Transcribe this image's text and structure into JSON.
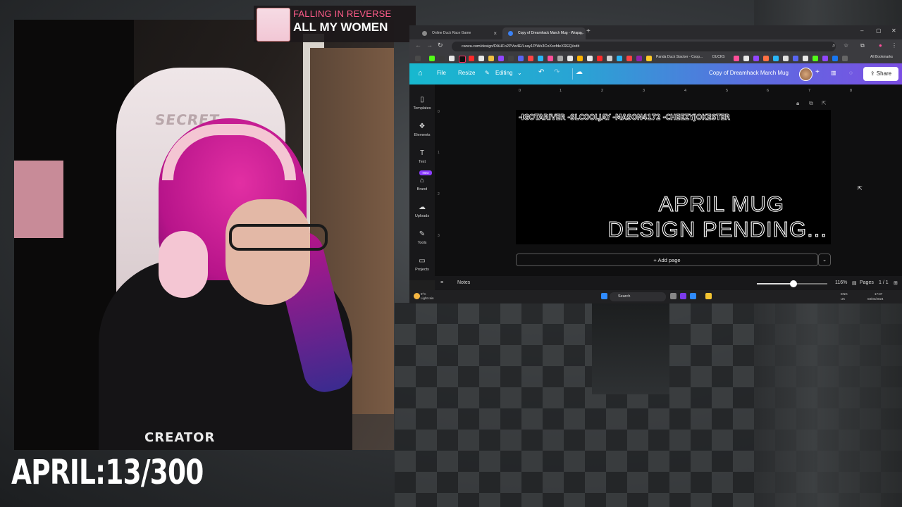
{
  "music": {
    "artist": "FALLING IN REVERSE",
    "song": "ALL MY WOMEN",
    "accent_color": "#ff5c8a"
  },
  "counter": {
    "text": "APRIL:13/300"
  },
  "webcam": {
    "chair_logo": "SECRET",
    "shirt_text": "CREATOR",
    "hair_color": "#d6209a"
  },
  "browser": {
    "tabs": [
      {
        "label": "Online Duck Race Game",
        "active": false,
        "icon": "duck-favicon-icon"
      },
      {
        "label": "Copy of Dreamhack March Mug - Wrapa...",
        "active": true,
        "icon": "canva-favicon-icon"
      }
    ],
    "url": "canva.com/design/DAHFo2PVw4E/Lsay1PIWs3CoXsxfdeXREQ/edit",
    "bookmark_items": [
      "Panda Duck Stacker - Coop...",
      "DUCKS",
      "All Bookmarks"
    ]
  },
  "canva": {
    "header": {
      "file": "File",
      "resize": "Resize",
      "editing": "Editing",
      "doc_title": "Copy of Dreamhack March Mug",
      "share": "Share",
      "accent_start": "#17b8cf",
      "accent_end": "#7b4ee3"
    },
    "sidebar": [
      {
        "label": "Templates",
        "icon": "templates-icon"
      },
      {
        "label": "Elements",
        "icon": "elements-icon"
      },
      {
        "label": "Text",
        "icon": "text-icon"
      },
      {
        "label": "Brand",
        "icon": "brand-icon"
      },
      {
        "label": "Uploads",
        "icon": "uploads-icon"
      },
      {
        "label": "Tools",
        "icon": "tools-icon"
      },
      {
        "label": "Projects",
        "icon": "projects-icon"
      }
    ],
    "new_badge": "New",
    "ruler_top": [
      "0",
      "1",
      "2",
      "3",
      "4",
      "5",
      "6",
      "7",
      "8"
    ],
    "ruler_left": [
      "0",
      "1",
      "2",
      "3"
    ],
    "design": {
      "names_line": "-IGOTARIVER -SLCOOLJAY -MASON4172 -CHEEZYJOKESTER",
      "line1": "APRIL MUG",
      "line2": "DESIGN PENDING..."
    },
    "add_page": "+ Add page",
    "footer": {
      "notes": "Notes",
      "zoom": "116%",
      "zoom_level": 0.52,
      "pages": "Pages",
      "page_count": "1 / 1"
    }
  },
  "taskbar": {
    "search_placeholder": "Search",
    "weather": "9°C",
    "weather_desc": "Light rain",
    "lang_top": "ENG",
    "lang_bottom": "UK",
    "time": "17:37",
    "date": "03/04/2024"
  }
}
